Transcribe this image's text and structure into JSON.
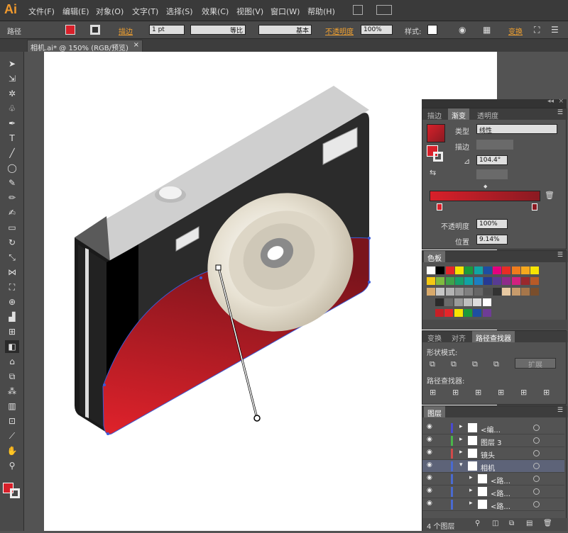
{
  "app": {
    "logo": "Ai"
  },
  "menu": [
    "文件(F)",
    "编辑(E)",
    "对象(O)",
    "文字(T)",
    "选择(S)",
    "效果(C)",
    "视图(V)",
    "窗口(W)",
    "帮助(H)"
  ],
  "control_bar": {
    "object_type": "路径",
    "stroke_label": "描边",
    "stroke_weight": "1 pt",
    "profile_label": "等比",
    "brush_label": "基本",
    "opacity_label": "不透明度",
    "opacity_value": "100%",
    "style_label": "样式:",
    "transform_label": "变换"
  },
  "document_tab": {
    "title": "相机.ai* @ 150% (RGB/预览)",
    "close": "×"
  },
  "gradient_panel": {
    "tabs": [
      "描边",
      "渐变",
      "透明度"
    ],
    "type_label": "类型",
    "type_value": "线性",
    "stroke_label": "描边",
    "angle_value": "104.4°",
    "opacity_label": "不透明度",
    "opacity_value": "100%",
    "location_label": "位置",
    "location_value": "9.14%",
    "colors": {
      "start": "#d8202a",
      "end": "#8a1a22"
    }
  },
  "swatches_panel": {
    "title": "色板",
    "row1": [
      "#ffffff",
      "#000000",
      "#e5262a",
      "#f7e400",
      "#1b9a3b",
      "#11a6a2",
      "#1e4ea1",
      "#e3007f",
      "#e72d25",
      "#ef7c1d",
      "#f6a91d",
      "#f7e400"
    ],
    "row2": [
      "#f4c813",
      "#7fbb3f",
      "#3ea24a",
      "#16a06c",
      "#11a3a3",
      "#1c7fc0",
      "#263a93",
      "#583b93",
      "#8e2c8a",
      "#d2217f",
      "#9a282d",
      "#b85a27"
    ],
    "row3": [
      "#d7a96b",
      "#c7c7c7",
      "#b3b3b3",
      "#9a9a9a",
      "#808080",
      "#666666",
      "#4d4d4d",
      "#333333",
      "#e8c9a2",
      "#c79b6c",
      "#a6764a",
      "#7a4e2c"
    ],
    "row4": [
      "#2b2b2b",
      "#6b6b6b",
      "#9a9a9a",
      "#bfbfbf",
      "#dedede",
      "#ffffff"
    ],
    "row5": [
      "#c71f26",
      "#e6262a",
      "#f7e400",
      "#1b9a3b",
      "#1e4ea1",
      "#6f3c96"
    ]
  },
  "align_panel": {
    "tabs": [
      "变换",
      "对齐",
      "路径查找器"
    ],
    "shape_modes_label": "形状模式:",
    "expand_label": "扩展",
    "pathfinders_label": "路径查找器:"
  },
  "layers_panel": {
    "title": "图层",
    "rows": [
      {
        "name": "<编...",
        "color": "#4a4ad0"
      },
      {
        "name": "图层 3",
        "color": "#4ab54a"
      },
      {
        "name": "镜头",
        "color": "#d04a4a"
      },
      {
        "name": "相机",
        "color": "#4a6ad0"
      },
      {
        "name": "<路...",
        "color": "#4a6ad0"
      },
      {
        "name": "<路...",
        "color": "#4a6ad0"
      },
      {
        "name": "<路...",
        "color": "#4a6ad0"
      }
    ],
    "footer": "4 个图层"
  }
}
